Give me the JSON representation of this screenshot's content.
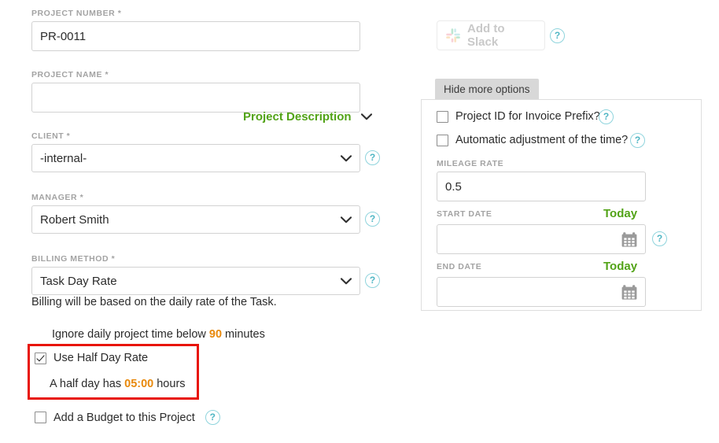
{
  "colors": {
    "green": "#52a317",
    "orange": "#e8890c",
    "help_blue": "#4fb6c4",
    "highlight_red": "#e8140a",
    "label_gray": "#a3a3a3"
  },
  "left_column": {
    "project_number": {
      "label": "PROJECT NUMBER *",
      "value": "PR-0011",
      "placeholder": ""
    },
    "project_name": {
      "label": "PROJECT NAME *",
      "value": "",
      "placeholder": ""
    },
    "project_description_toggle": {
      "label": "Project Description",
      "icon": "chevron-down-icon"
    },
    "client": {
      "label": "CLIENT *",
      "value": "-internal-",
      "help": "?"
    },
    "manager": {
      "label": "MANAGER *",
      "value": "Robert Smith",
      "help": "?"
    },
    "billing_method": {
      "label": "BILLING METHOD *",
      "value": "Task Day Rate",
      "help": "?",
      "note": "Billing will be based on the daily rate of the Task."
    },
    "ignore_time": {
      "prefix": "Ignore daily project time below ",
      "value": "90",
      "suffix": " minutes"
    },
    "half_day_rate": {
      "label": "Use Half Day Rate",
      "checked": true,
      "note_prefix": "A half day has ",
      "note_value": "05:00",
      "note_suffix": " hours"
    },
    "add_budget": {
      "label": "Add a Budget to this Project",
      "checked": false,
      "help": "?"
    }
  },
  "right_column": {
    "slack_button": {
      "label": "Add to Slack",
      "icon": "slack-logo-icon",
      "help": "?"
    },
    "hide_more_options": {
      "label": "Hide more options"
    },
    "invoice_prefix": {
      "label": "Project ID for Invoice Prefix?",
      "checked": false,
      "help": "?"
    },
    "auto_adjust": {
      "label": "Automatic adjustment of the time?",
      "checked": false,
      "help": "?"
    },
    "mileage_rate": {
      "label": "MILEAGE RATE",
      "value": "0.5"
    },
    "start_date": {
      "label": "START DATE",
      "today_link": "Today",
      "value": "",
      "icon": "calendar-icon",
      "help": "?"
    },
    "end_date": {
      "label": "END DATE",
      "today_link": "Today",
      "value": "",
      "icon": "calendar-icon"
    }
  }
}
